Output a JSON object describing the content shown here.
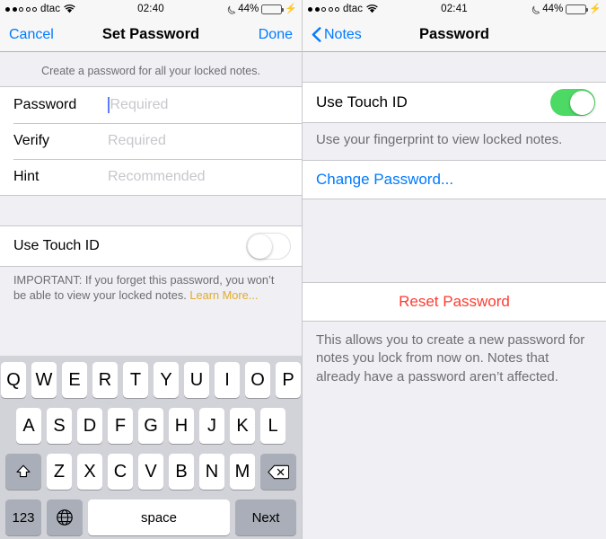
{
  "left": {
    "statusbar": {
      "carrier": "dtac",
      "signal_filled": 2,
      "signal_total": 5,
      "time": "02:40",
      "battery_percent": "44%",
      "battery_level": 44,
      "dnd_icon": "moon-icon",
      "wifi_icon": "wifi-icon",
      "charging_icon": "lightning-bolt-icon",
      "battery_color": "#f5c518"
    },
    "nav": {
      "cancel_label": "Cancel",
      "title": "Set Password",
      "done_label": "Done"
    },
    "section_header": "Create a password for all your locked notes.",
    "fields": [
      {
        "label": "Password",
        "value": "",
        "placeholder": "Required",
        "focused": true
      },
      {
        "label": "Verify",
        "value": "",
        "placeholder": "Required",
        "focused": false
      },
      {
        "label": "Hint",
        "value": "",
        "placeholder": "Recommended",
        "focused": false
      }
    ],
    "touch_id": {
      "label": "Use Touch ID",
      "state": "off"
    },
    "footer": {
      "text": "IMPORTANT: If you forget this password, you won’t be able to view your locked notes. ",
      "link": "Learn More...",
      "link_color": "#e3ab2c"
    },
    "keyboard": {
      "row1": [
        "Q",
        "W",
        "E",
        "R",
        "T",
        "Y",
        "U",
        "I",
        "O",
        "P"
      ],
      "row2": [
        "A",
        "S",
        "D",
        "F",
        "G",
        "H",
        "J",
        "K",
        "L"
      ],
      "row3": [
        "Z",
        "X",
        "C",
        "V",
        "B",
        "N",
        "M"
      ],
      "shift_icon": "shift-arrow-icon",
      "backspace_icon": "backspace-icon",
      "numbers_label": "123",
      "globe_icon": "globe-icon",
      "space_label": "space",
      "return_label": "Next"
    }
  },
  "right": {
    "statusbar": {
      "carrier": "dtac",
      "signal_filled": 2,
      "signal_total": 5,
      "time": "02:41",
      "battery_percent": "44%",
      "battery_level": 44,
      "dnd_icon": "moon-icon",
      "wifi_icon": "wifi-icon",
      "charging_icon": "lightning-bolt-icon",
      "battery_color": "#f5c518"
    },
    "nav": {
      "back_label": "Notes",
      "back_icon": "chevron-left-icon",
      "title": "Password"
    },
    "touch_id": {
      "label": "Use Touch ID",
      "state": "on",
      "on_color": "#4cd964"
    },
    "touch_id_footer": "Use your fingerprint to view locked notes.",
    "change_password_label": "Change Password...",
    "change_password_color": "#007aff",
    "reset_password_label": "Reset Password",
    "reset_password_color": "#ff3b30",
    "reset_footer": "This allows you to create a new password for notes you lock from now on. Notes that already have a password aren’t affected."
  }
}
